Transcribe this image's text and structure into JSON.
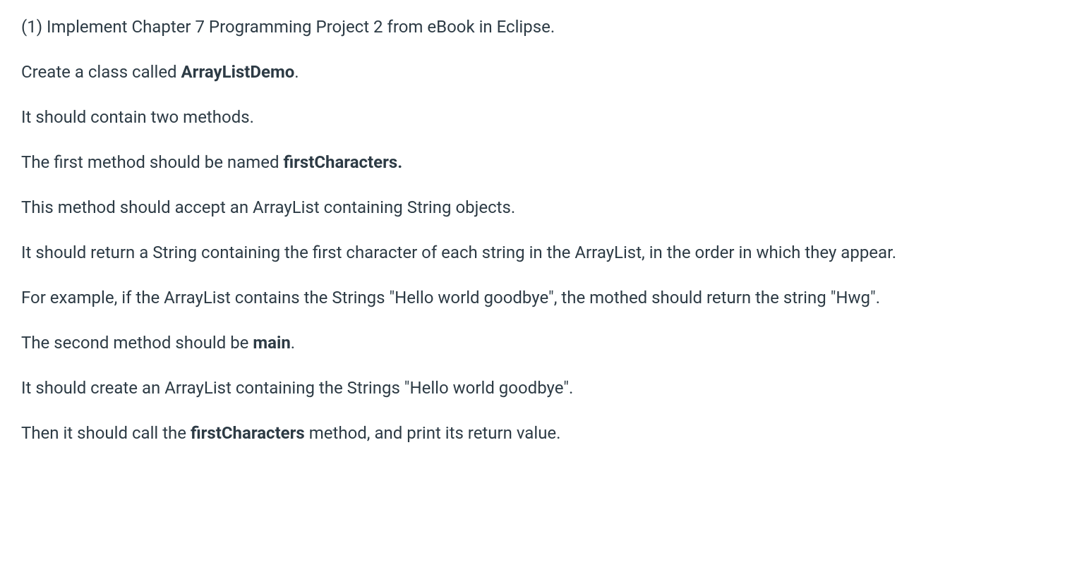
{
  "paragraphs": {
    "p1": "(1) Implement Chapter 7 Programming Project 2 from eBook in Eclipse.",
    "p2_prefix": "Create a class called ",
    "p2_bold": "ArrayListDemo",
    "p2_suffix": ".",
    "p3": "It should contain two methods.",
    "p4_prefix": "The first method should be named ",
    "p4_bold": "firstCharacters.",
    "p5": "This method should accept an ArrayList containing String objects.",
    "p6": "It should return a String containing the first character of each string in the ArrayList, in the order in which they appear.",
    "p7": "For example, if the ArrayList contains the Strings \"Hello world goodbye\", the mothed should return the string \"Hwg\".",
    "p8_prefix": "The second method should be ",
    "p8_bold": "main",
    "p8_suffix": ".",
    "p9": "It should create an ArrayList containing the Strings \"Hello world goodbye\".",
    "p10_prefix": "Then it should call the ",
    "p10_bold": "firstCharacters",
    "p10_suffix": " method, and print its return value."
  }
}
